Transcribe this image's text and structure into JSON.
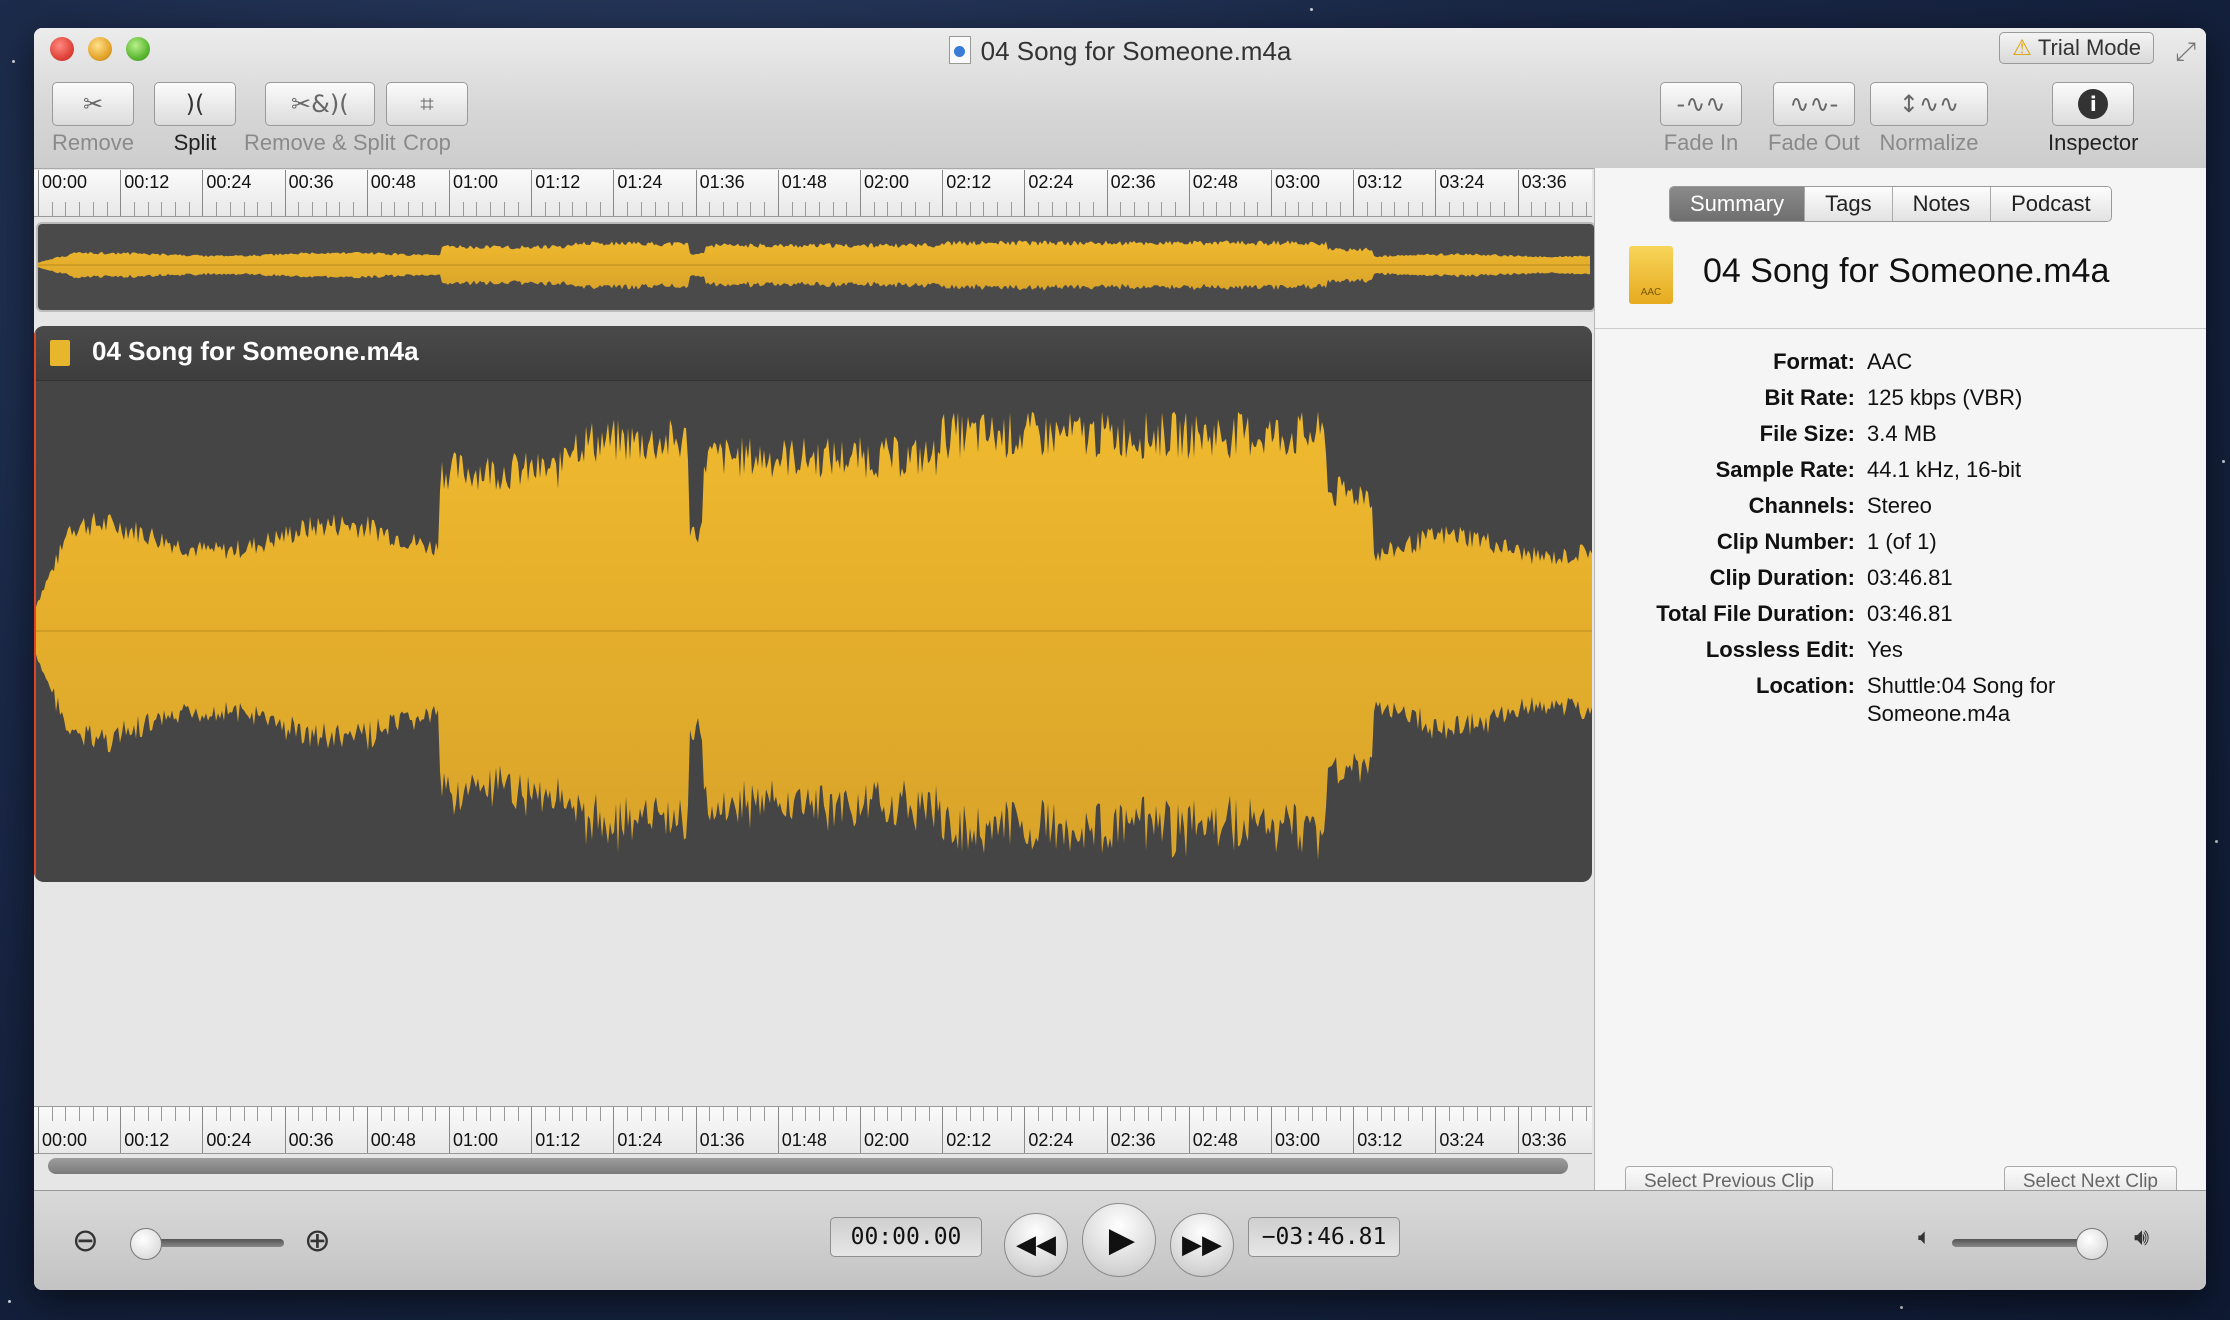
{
  "window": {
    "title": "04 Song for Someone.m4a",
    "trial_label": "Trial Mode"
  },
  "toolbar": {
    "left": [
      {
        "label": "Remove",
        "glyph": "✂",
        "active": false
      },
      {
        "label": "Split",
        "glyph": ")(",
        "active": true
      },
      {
        "label": "Remove & Split",
        "glyph": "✂&)(",
        "active": false
      },
      {
        "label": "Crop",
        "glyph": "⌗",
        "active": false
      }
    ],
    "right": [
      {
        "label": "Fade In",
        "glyph": "-∿∿",
        "active": false
      },
      {
        "label": "Fade Out",
        "glyph": "∿∿-",
        "active": false
      },
      {
        "label": "Normalize",
        "glyph": "↕∿∿",
        "active": false
      },
      {
        "label": "Inspector",
        "glyph": "i",
        "active": true
      }
    ]
  },
  "timeline": {
    "labels": [
      "00:00",
      "00:12",
      "00:24",
      "00:36",
      "00:48",
      "01:00",
      "01:12",
      "01:24",
      "01:36",
      "01:48",
      "02:00",
      "02:12",
      "02:24",
      "02:36",
      "02:48",
      "03:00",
      "03:12",
      "03:24",
      "03:36"
    ]
  },
  "clip": {
    "title": "04 Song for Someone.m4a"
  },
  "inspector": {
    "tabs": [
      "Summary",
      "Tags",
      "Notes",
      "Podcast"
    ],
    "selected_tab": "Summary",
    "file_title": "04 Song for Someone.m4a",
    "icon_label": "AAC",
    "properties": [
      {
        "key": "Format:",
        "value": "AAC"
      },
      {
        "key": "Bit Rate:",
        "value": "125 kbps (VBR)"
      },
      {
        "key": "File Size:",
        "value": "3.4 MB"
      },
      {
        "key": "Sample Rate:",
        "value": "44.1 kHz, 16-bit"
      },
      {
        "key": "Channels:",
        "value": "Stereo"
      },
      {
        "key": "Clip Number:",
        "value": "1 (of  1)"
      },
      {
        "key": "Clip Duration:",
        "value": "03:46.81"
      },
      {
        "key": "Total File Duration:",
        "value": "03:46.81"
      },
      {
        "key": "Lossless Edit:",
        "value": "Yes"
      },
      {
        "key": "Location:",
        "value": "Shuttle:04 Song for Someone.m4a"
      }
    ],
    "prev_clip_label": "Select Previous Clip",
    "next_clip_label": "Select Next Clip"
  },
  "transport": {
    "current_time": "00:00.00",
    "remaining_time": "−03:46.81",
    "zoom_level": 0,
    "volume_level": 0.95
  },
  "colors": {
    "waveform": "#efb92e",
    "waveform_dark": "#d9a32a",
    "background": "#454545"
  }
}
